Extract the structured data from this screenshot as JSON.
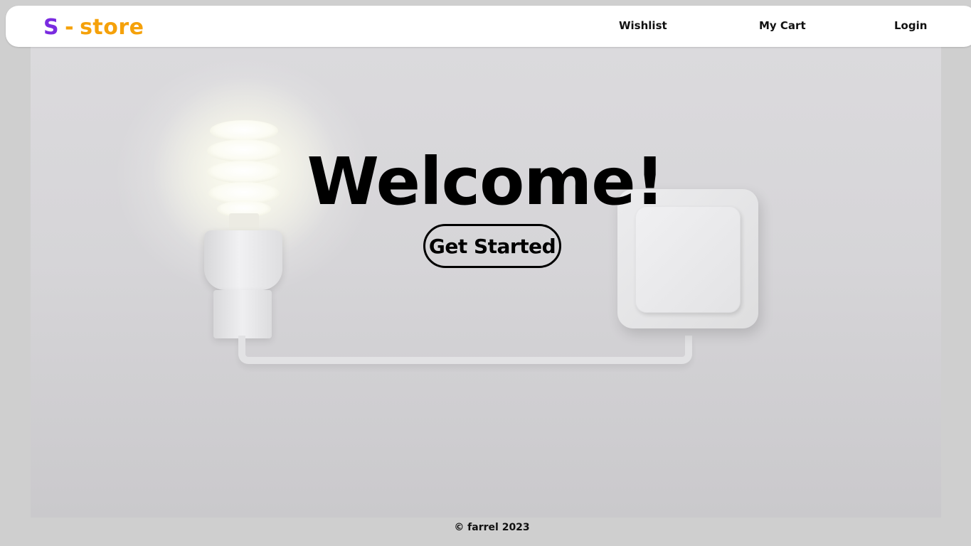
{
  "brand": {
    "letter": "S",
    "separator": "-",
    "name": "store",
    "letter_color": "#7a2be0",
    "name_color": "#f5a10a"
  },
  "nav": {
    "items": [
      {
        "label": "Wishlist"
      },
      {
        "label": "My Cart"
      },
      {
        "label": "Login"
      }
    ]
  },
  "hero": {
    "heading": "Welcome!",
    "cta_label": "Get Started",
    "background_image": "light-bulb-and-wall-switch"
  },
  "footer": {
    "text": "© farrel 2023"
  }
}
